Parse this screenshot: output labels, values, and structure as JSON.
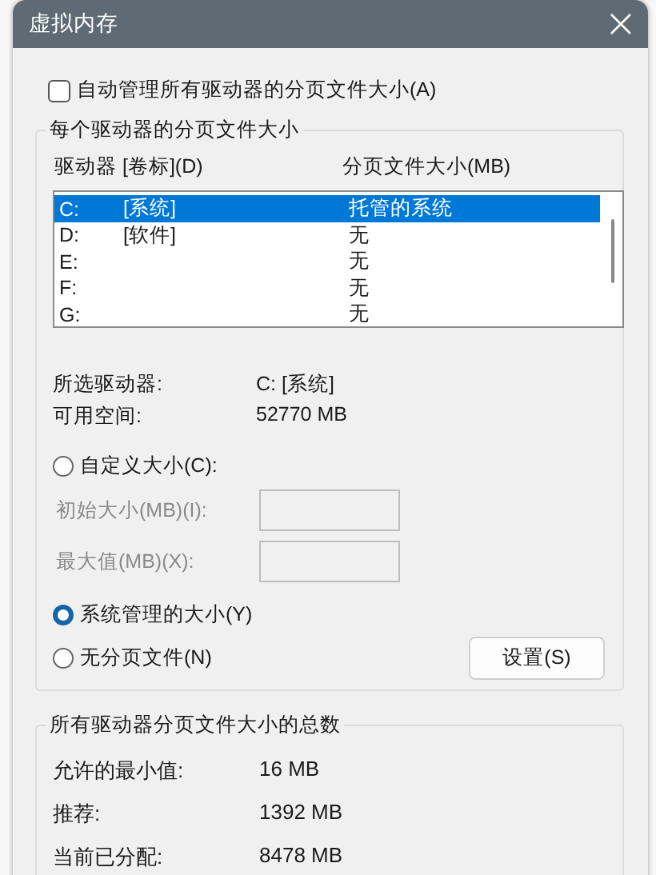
{
  "window": {
    "title": "虚拟内存"
  },
  "auto_manage": {
    "label": "自动管理所有驱动器的分页文件大小(A)",
    "checked": false
  },
  "per_drive": {
    "title": "每个驱动器的分页文件大小",
    "columns": [
      "驱动器 [卷标](D)",
      "分页文件大小(MB)"
    ],
    "drives": [
      {
        "drive": "C:",
        "label": "[系统]",
        "size": "托管的系统",
        "selected": true
      },
      {
        "drive": "D:",
        "label": "[软件]",
        "size": "无",
        "selected": false
      },
      {
        "drive": "E:",
        "size": "无",
        "selected": false
      },
      {
        "drive": "F:",
        "size": "无",
        "selected": false
      },
      {
        "drive": "G:",
        "size": "无",
        "selected": false
      }
    ],
    "selected_drive": {
      "label": "所选驱动器:",
      "value": "C:  [系统]"
    },
    "free_space": {
      "label": "可用空间:",
      "value": "52770 MB"
    },
    "size_options": [
      {
        "label": "自定义大小(C):",
        "selected": false
      },
      {
        "label": "系统管理的大小(Y)",
        "selected": true
      },
      {
        "label": "无分页文件(N)",
        "selected": false
      }
    ],
    "fields": [
      {
        "label": "初始大小(MB)(I):",
        "disabled": true
      },
      {
        "label": "最大值(MB)(X):",
        "disabled": true
      }
    ],
    "set_button": "设置(S)"
  },
  "totals": {
    "title": "所有驱动器分页文件大小的总数",
    "rows": [
      {
        "label": "允许的最小值:",
        "value": "16 MB"
      },
      {
        "label": "推荐:",
        "value": "1392 MB"
      },
      {
        "label": "当前已分配:",
        "value": "8478 MB"
      }
    ]
  }
}
